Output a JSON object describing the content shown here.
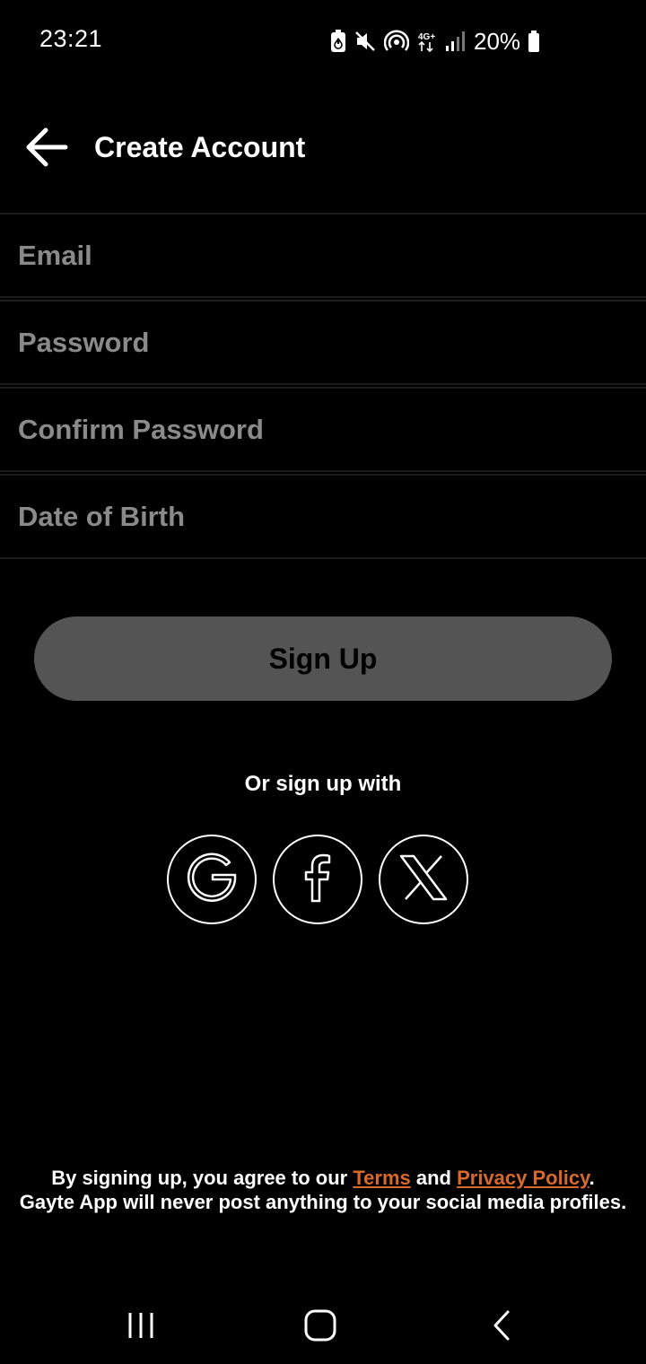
{
  "status_bar": {
    "time": "23:21",
    "battery": "20%",
    "network": "4G+",
    "icons": [
      "battery-saver-icon",
      "mute-icon",
      "hotspot-icon",
      "network-4g-icon",
      "signal-icon",
      "battery-icon"
    ]
  },
  "app_bar": {
    "title": "Create Account",
    "back_icon": "arrow-left-icon"
  },
  "form": {
    "email_placeholder": "Email",
    "password_placeholder": "Password",
    "confirm_password_placeholder": "Confirm Password",
    "dob_placeholder": "Date of Birth",
    "email_value": "",
    "password_value": "",
    "confirm_password_value": "",
    "dob_value": ""
  },
  "signup_button_label": "Sign Up",
  "social": {
    "caption": "Or sign up with",
    "providers": [
      "google-icon",
      "facebook-icon",
      "x-icon"
    ]
  },
  "legal": {
    "prefix": "By signing up, you agree to our ",
    "terms": "Terms",
    "and": " and ",
    "privacy": "Privacy Policy",
    "suffix": ".",
    "line2": "Gayte App will never post anything to your social media profiles."
  },
  "colors": {
    "background": "#000000",
    "button_disabled": "#555454",
    "link": "#d9692b",
    "placeholder": "#8a8a8a"
  },
  "nav_bar": {
    "icons": [
      "recent-apps-icon",
      "home-icon",
      "back-nav-icon"
    ]
  }
}
